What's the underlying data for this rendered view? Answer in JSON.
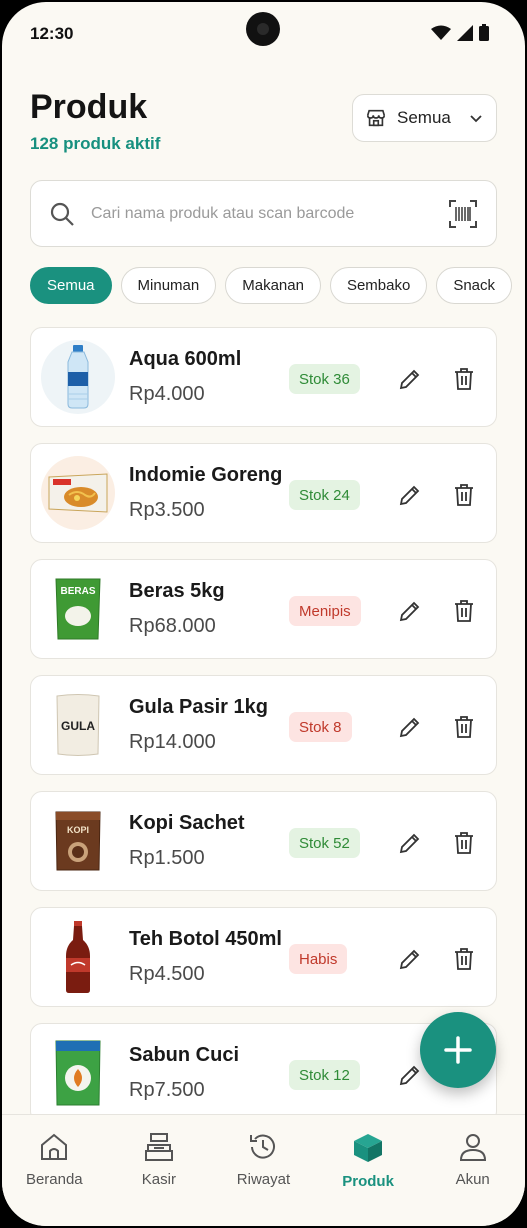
{
  "status_bar": {
    "time": "12:30"
  },
  "header": {
    "title": "Produk",
    "subtitle": "128 produk aktif",
    "store_filter": "Semua"
  },
  "search": {
    "placeholder": "Cari nama produk atau scan barcode"
  },
  "categories": [
    "Semua",
    "Minuman",
    "Makanan",
    "Sembako",
    "Snack"
  ],
  "products": [
    {
      "name": "Aqua 600ml",
      "price": "Rp4.000",
      "stock": "Stok 36",
      "stock_status": "ok",
      "icon": "water-bottle-icon"
    },
    {
      "name": "Indomie Goreng",
      "price": "Rp3.500",
      "stock": "Stok 24",
      "stock_status": "ok",
      "icon": "noodle-pack-icon"
    },
    {
      "name": "Beras 5kg",
      "price": "Rp68.000",
      "stock": "Menipis",
      "stock_status": "warn",
      "icon": "rice-bag-icon",
      "package_label": "BERAS"
    },
    {
      "name": "Gula Pasir 1kg",
      "price": "Rp14.000",
      "stock": "Stok 8",
      "stock_status": "warn",
      "icon": "sugar-bag-icon",
      "package_label": "GULA"
    },
    {
      "name": "Kopi Sachet",
      "price": "Rp1.500",
      "stock": "Stok 52",
      "stock_status": "ok",
      "icon": "coffee-sachet-icon",
      "package_label": "KOPI"
    },
    {
      "name": "Teh Botol 450ml",
      "price": "Rp4.500",
      "stock": "Habis",
      "stock_status": "warn",
      "icon": "tea-bottle-icon"
    },
    {
      "name": "Sabun Cuci",
      "price": "Rp7.500",
      "stock": "Stok 12",
      "stock_status": "ok",
      "icon": "detergent-pack-icon"
    }
  ],
  "bottom_nav": [
    {
      "label": "Beranda",
      "icon": "home-icon",
      "active": false
    },
    {
      "label": "Kasir",
      "icon": "cash-register-icon",
      "active": false
    },
    {
      "label": "Riwayat",
      "icon": "history-icon",
      "active": false
    },
    {
      "label": "Produk",
      "icon": "box-icon",
      "active": true
    },
    {
      "label": "Akun",
      "icon": "user-icon",
      "active": false
    }
  ],
  "colors": {
    "accent": "#1a917f",
    "background": "#fbf9f3",
    "stock_ok_bg": "#e4f3e2",
    "stock_ok_text": "#2f8b37",
    "stock_warn_bg": "#fde4e2",
    "stock_warn_text": "#c0392b"
  }
}
